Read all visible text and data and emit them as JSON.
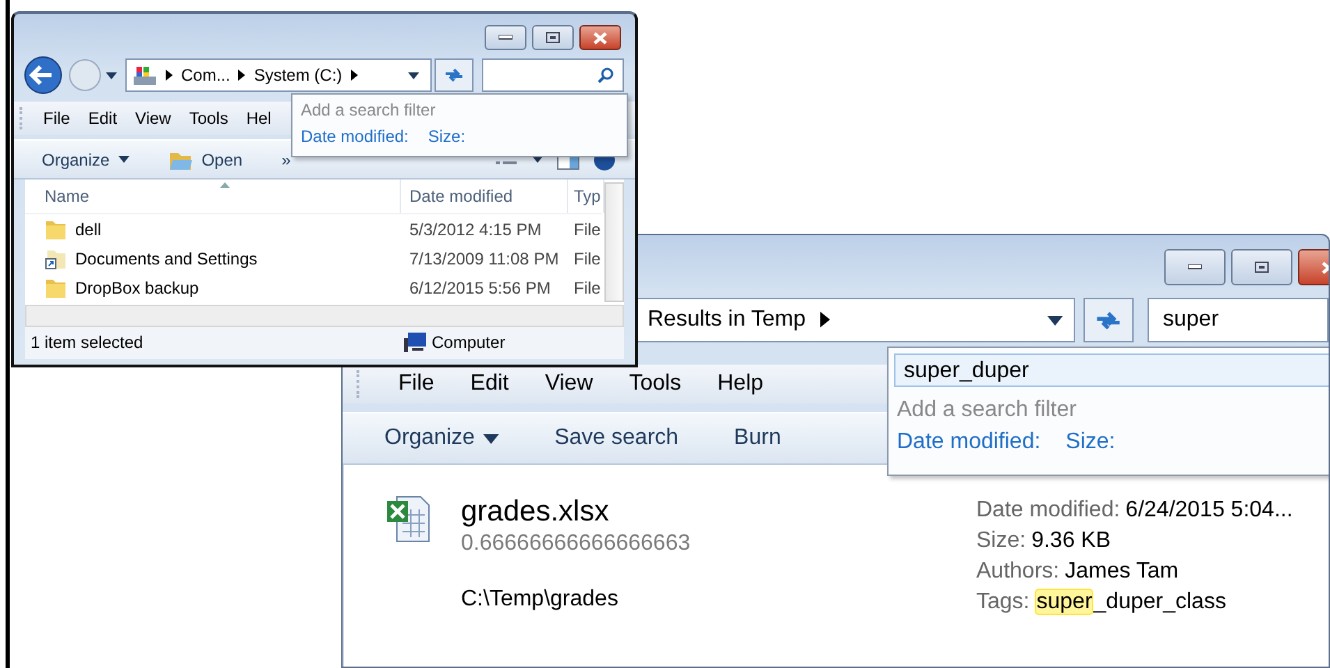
{
  "small_window": {
    "address": {
      "crumbs": [
        "Com...",
        "System (C:)"
      ]
    },
    "search_popup": {
      "heading": "Add a search filter",
      "filters": [
        "Date modified:",
        "Size:"
      ]
    },
    "menu": [
      "File",
      "Edit",
      "View",
      "Tools",
      "Hel"
    ],
    "commands": [
      {
        "label": "Organize",
        "kind": "dropdown"
      },
      {
        "label": "Open",
        "kind": "open"
      },
      {
        "label": "»",
        "kind": "plain"
      }
    ],
    "columns": [
      "Name",
      "Date modified",
      "Typ"
    ],
    "rows": [
      {
        "kind": "folder",
        "name": "dell",
        "date": "5/3/2012 4:15 PM",
        "type": "File"
      },
      {
        "kind": "shortcut",
        "name": "Documents and Settings",
        "date": "7/13/2009 11:08 PM",
        "type": "File"
      },
      {
        "kind": "folder",
        "name": "DropBox backup",
        "date": "6/12/2015 5:56 PM",
        "type": "File"
      }
    ],
    "status": {
      "text": "1 item selected",
      "location": "Computer"
    }
  },
  "large_window": {
    "address": {
      "crumbs": [
        "Results in Temp"
      ]
    },
    "search": {
      "value": "super"
    },
    "search_popup": {
      "suggestion": "super_duper",
      "heading": "Add a search filter",
      "filters": [
        "Date modified:",
        "Size:"
      ]
    },
    "menu": [
      "File",
      "Edit",
      "View",
      "Tools",
      "Help"
    ],
    "commands": [
      {
        "label": "Organize",
        "kind": "dropdown"
      },
      {
        "label": "Save search",
        "kind": "plain"
      },
      {
        "label": "Burn",
        "kind": "plain"
      }
    ],
    "result": {
      "name": "grades.xlsx",
      "detail": "0.66666666666666663",
      "path": "C:\\Temp\\grades",
      "properties": [
        {
          "label": "Date modified:",
          "value": "6/24/2015 5:04..."
        },
        {
          "label": "Size:",
          "value": "9.36 KB"
        },
        {
          "label": "Authors:",
          "value": "James Tam"
        },
        {
          "label": "Tags:",
          "highlight": "super",
          "value": "_duper_class"
        }
      ]
    }
  }
}
